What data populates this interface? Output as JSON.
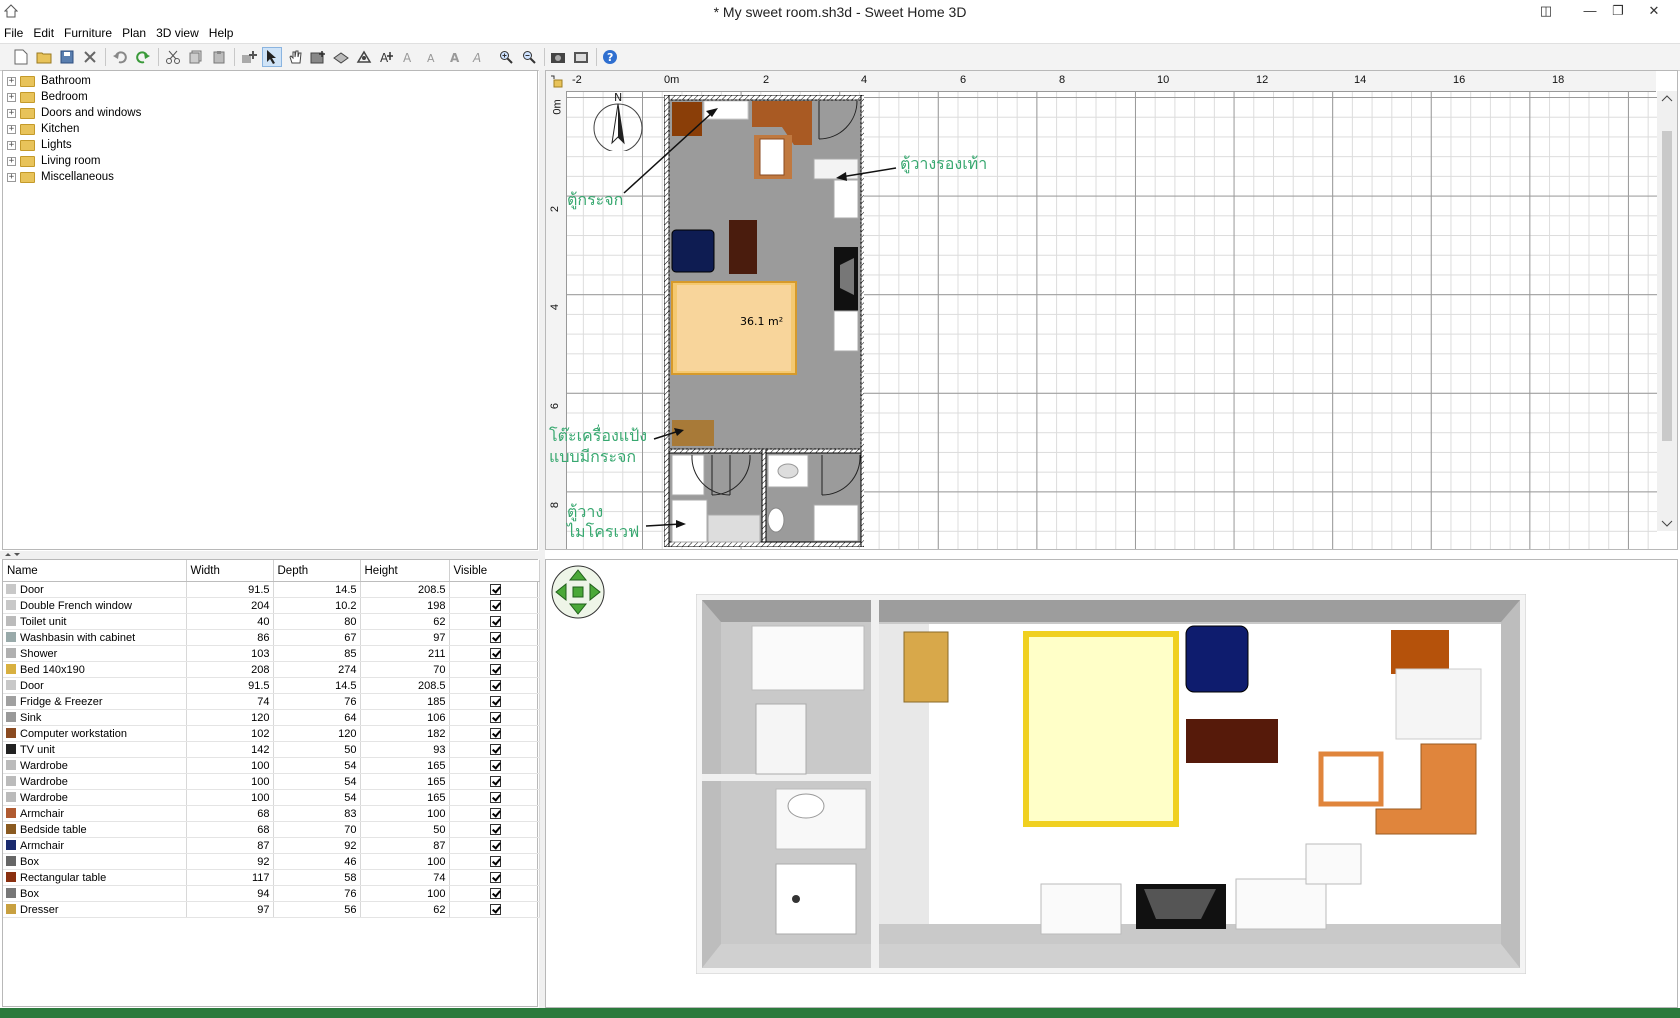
{
  "window": {
    "title": "* My sweet room.sh3d - Sweet Home 3D"
  },
  "menu": [
    "File",
    "Edit",
    "Furniture",
    "Plan",
    "3D view",
    "Help"
  ],
  "toolbar_icons": [
    "new-icon",
    "open-icon",
    "save-icon",
    "cut-prefs-icon",
    "undo-icon",
    "redo-icon",
    "cut-icon",
    "copy-icon",
    "paste-icon",
    "add-furniture-icon",
    "select-icon",
    "pan-icon",
    "create-walls-icon",
    "create-rooms-icon",
    "create-dimensions-icon",
    "add-text-icon",
    "increase-text-icon",
    "decrease-text-icon",
    "bold-text-icon",
    "italic-text-icon",
    "zoom-in-icon",
    "zoom-out-icon",
    "create-photo-icon",
    "create-video-icon",
    "help-icon"
  ],
  "catalog": {
    "categories": [
      "Bathroom",
      "Bedroom",
      "Doors and windows",
      "Kitchen",
      "Lights",
      "Living room",
      "Miscellaneous"
    ]
  },
  "furniture_table": {
    "columns": [
      "Name",
      "Width",
      "Depth",
      "Height",
      "Visible"
    ],
    "rows": [
      {
        "name": "Door",
        "width": "91.5",
        "depth": "14.5",
        "height": "208.5"
      },
      {
        "name": "Double French window",
        "width": "204",
        "depth": "10.2",
        "height": "198"
      },
      {
        "name": "Toilet unit",
        "width": "40",
        "depth": "80",
        "height": "62"
      },
      {
        "name": "Washbasin with cabinet",
        "width": "86",
        "depth": "67",
        "height": "97"
      },
      {
        "name": "Shower",
        "width": "103",
        "depth": "85",
        "height": "211"
      },
      {
        "name": "Bed 140x190",
        "width": "208",
        "depth": "274",
        "height": "70"
      },
      {
        "name": "Door",
        "width": "91.5",
        "depth": "14.5",
        "height": "208.5"
      },
      {
        "name": "Fridge & Freezer",
        "width": "74",
        "depth": "76",
        "height": "185"
      },
      {
        "name": "Sink",
        "width": "120",
        "depth": "64",
        "height": "106"
      },
      {
        "name": "Computer workstation",
        "width": "102",
        "depth": "120",
        "height": "182"
      },
      {
        "name": "TV unit",
        "width": "142",
        "depth": "50",
        "height": "93"
      },
      {
        "name": "Wardrobe",
        "width": "100",
        "depth": "54",
        "height": "165"
      },
      {
        "name": "Wardrobe",
        "width": "100",
        "depth": "54",
        "height": "165"
      },
      {
        "name": "Wardrobe",
        "width": "100",
        "depth": "54",
        "height": "165"
      },
      {
        "name": "Armchair",
        "width": "68",
        "depth": "83",
        "height": "100"
      },
      {
        "name": "Bedside table",
        "width": "68",
        "depth": "70",
        "height": "50"
      },
      {
        "name": "Armchair",
        "width": "87",
        "depth": "92",
        "height": "87"
      },
      {
        "name": "Box",
        "width": "92",
        "depth": "46",
        "height": "100"
      },
      {
        "name": "Rectangular table",
        "width": "117",
        "depth": "58",
        "height": "74"
      },
      {
        "name": "Box",
        "width": "94",
        "depth": "76",
        "height": "100"
      },
      {
        "name": "Dresser",
        "width": "97",
        "depth": "56",
        "height": "62"
      }
    ]
  },
  "plan": {
    "ruler_h": [
      "-2",
      "0m",
      "2",
      "4",
      "6",
      "8",
      "10",
      "12",
      "14",
      "16",
      "18"
    ],
    "ruler_v": [
      "0m",
      "2",
      "4",
      "6",
      "8"
    ],
    "compass": "N",
    "room_area": "36.1 m²",
    "annotations": {
      "mirror_cabinet": "ตู้กระจก",
      "shoe_rack": "ตู้วางรองเท้า",
      "dresser_line1": "โต๊ะเครื่องแป้ง",
      "dresser_line2": "แบบมีกระจก",
      "microwave_line1": "ตู้วาง",
      "microwave_line2": "ไมโครเวฟ"
    }
  }
}
